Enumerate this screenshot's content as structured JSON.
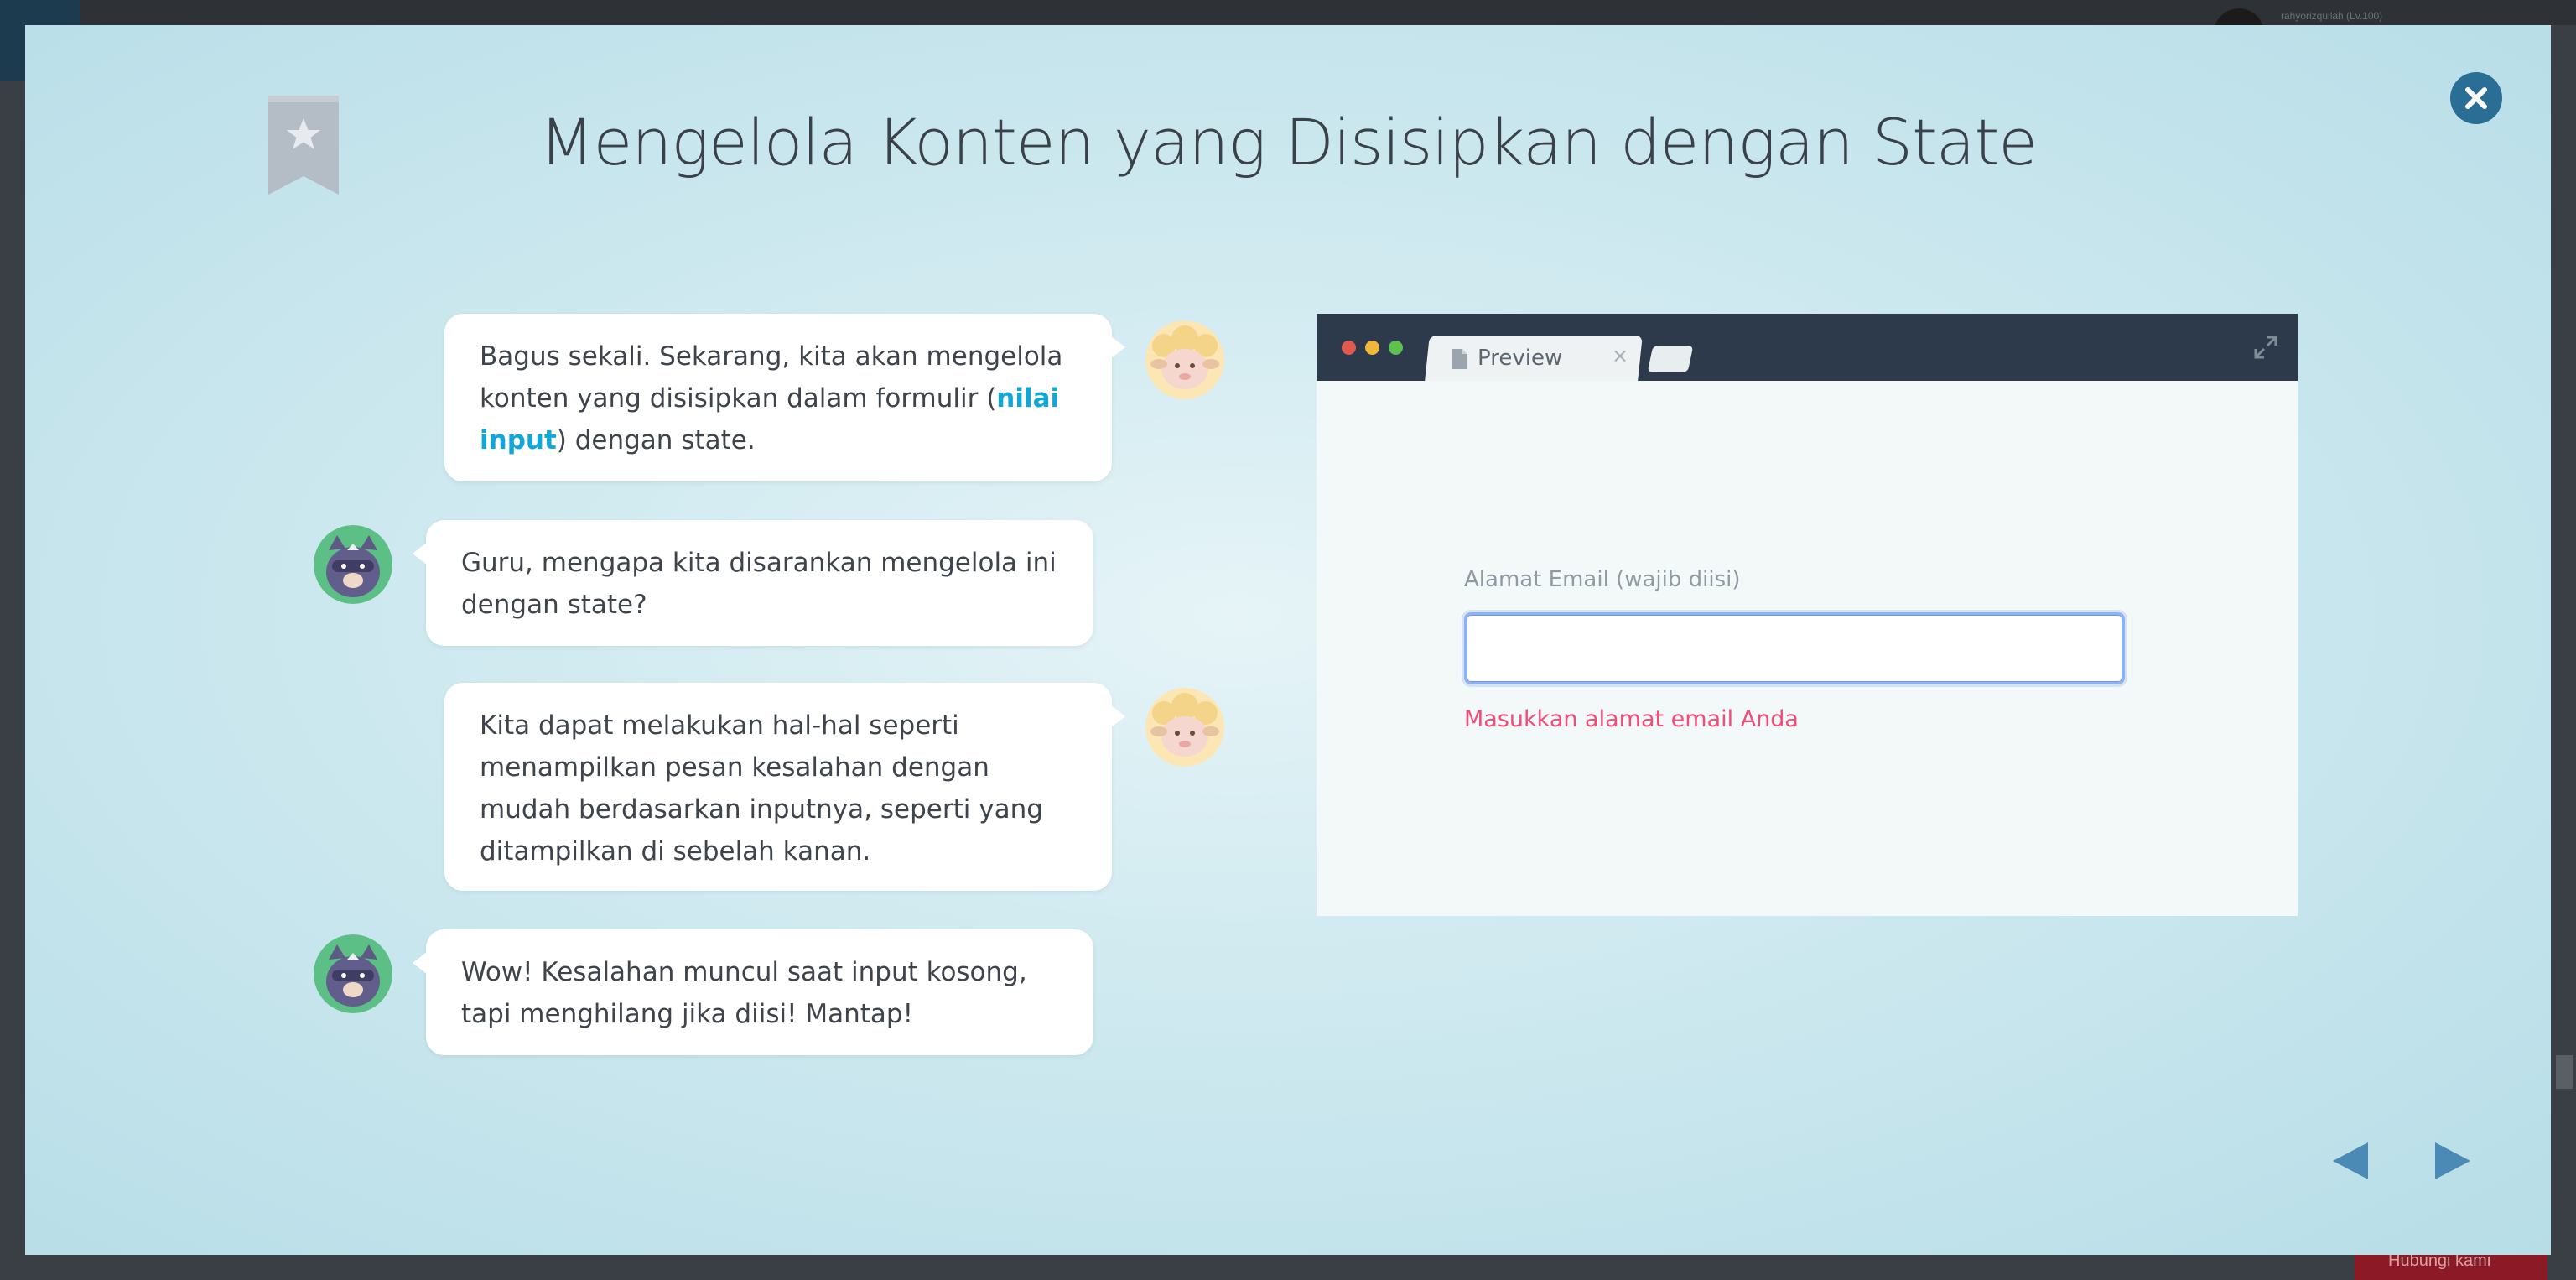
{
  "background": {
    "user_text": "rahyorizqullah (Lv.100)",
    "bottom_button_label": "Hubungi kami"
  },
  "lesson": {
    "title": "Mengelola Konten yang Disisipkan dengan State",
    "bookmark_icon": "bookmark-star-icon",
    "close_icon": "close-icon"
  },
  "dialogue": [
    {
      "speaker": "teacher",
      "text_before": "Bagus sekali. Sekarang, kita akan mengelola konten yang disisipkan dalam formulir (",
      "highlight": "nilai input",
      "text_after": ") dengan state."
    },
    {
      "speaker": "student",
      "text": "Guru, mengapa kita disarankan mengelola ini dengan state?"
    },
    {
      "speaker": "teacher",
      "text": "Kita dapat melakukan hal-hal seperti menampilkan pesan kesalahan dengan mudah berdasarkan inputnya, seperti yang ditampilkan di sebelah kanan."
    },
    {
      "speaker": "student",
      "text": "Wow! Kesalahan muncul saat input kosong, tapi menghilang jika diisi! Mantap!"
    }
  ],
  "preview": {
    "tab_label": "Preview",
    "tab_close": "×",
    "field_label": "Alamat Email (wajib diisi)",
    "field_value": "",
    "field_placeholder": "",
    "error_message": "Masukkan alamat email Anda"
  },
  "navigation": {
    "prev_icon": "triangle-left-icon",
    "next_icon": "triangle-right-icon"
  },
  "colors": {
    "accent_highlight": "#11a7d8",
    "error": "#f04d78",
    "close_button": "#2a6d95",
    "nav_arrow": "#4a8ab5"
  }
}
